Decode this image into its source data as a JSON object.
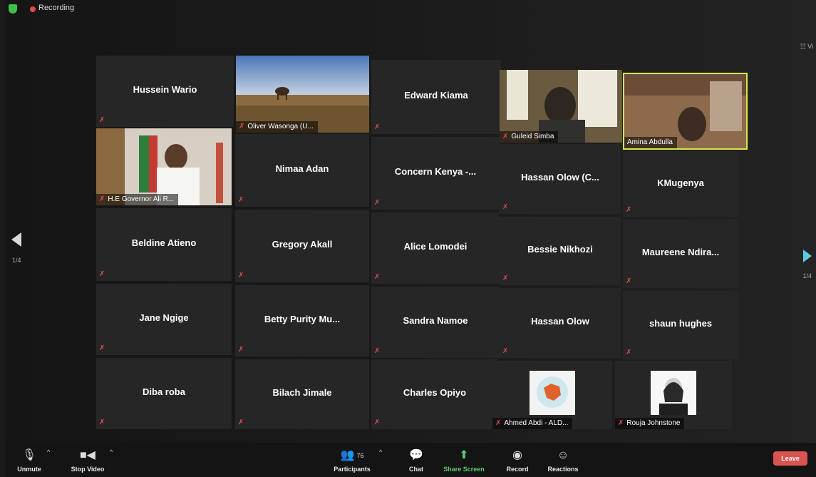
{
  "window": {
    "recording_label": "Recording",
    "view_label": "☷ Vi"
  },
  "pagination": {
    "left": "1/4",
    "right": "1/4"
  },
  "participants": [
    {
      "name": "Hussein Wario"
    },
    {
      "name": "Oliver Wasonga (U..."
    },
    {
      "name": "Edward Kiama"
    },
    {
      "name": "Guleid Simba"
    },
    {
      "name": "Amina Abdulla"
    },
    {
      "name": "H.E Governor Ali R..."
    },
    {
      "name": "Nimaa Adan"
    },
    {
      "name": "Concern Kenya -..."
    },
    {
      "name": "Hassan Olow (C..."
    },
    {
      "name": "KMugenya"
    },
    {
      "name": "Beldine Atieno"
    },
    {
      "name": "Gregory Akall"
    },
    {
      "name": "Alice Lomodei"
    },
    {
      "name": "Bessie Nikhozi"
    },
    {
      "name": "Maureene Ndira..."
    },
    {
      "name": "Jane Ngige"
    },
    {
      "name": "Betty Purity Mu..."
    },
    {
      "name": "Sandra Namoe"
    },
    {
      "name": "Hassan Olow"
    },
    {
      "name": "shaun hughes"
    },
    {
      "name": "Diba roba"
    },
    {
      "name": "Bilach Jimale"
    },
    {
      "name": "Charles Opiyo"
    },
    {
      "name": "Ahmed Abdi - ALD..."
    },
    {
      "name": "Rouja Johnstone"
    }
  ],
  "toolbar": {
    "unmute": "Unmute",
    "stop_video": "Stop Video",
    "participants": "Participants",
    "participant_count": "76",
    "chat": "Chat",
    "share_screen": "Share Screen",
    "record": "Record",
    "reactions": "Reactions",
    "leave": "Leave"
  },
  "colors": {
    "accent_green": "#3fbf4a",
    "share_green": "#5ecb6a",
    "leave_red": "#d9534f",
    "active_speaker": "#d3e84a"
  }
}
